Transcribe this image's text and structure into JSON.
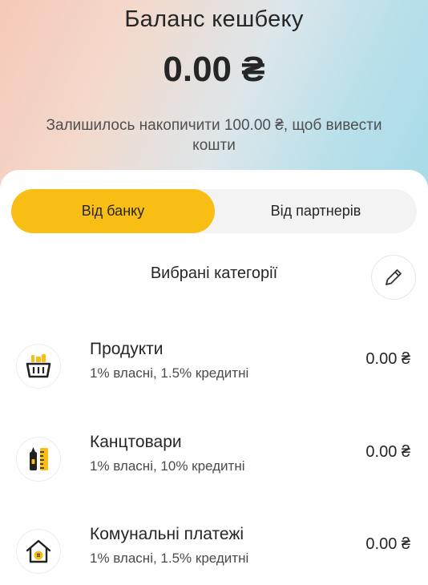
{
  "balance": {
    "title": "Баланс кешбеку",
    "amount": "0.00 ₴",
    "note": "Залишилось накопичити 100.00 ₴, щоб вивести кошти"
  },
  "tabs": [
    {
      "label": "Від банку",
      "active": true
    },
    {
      "label": "Від партнерів",
      "active": false
    }
  ],
  "categories": {
    "title": "Вибрані категорії",
    "edit_icon": "pencil-icon",
    "items": [
      {
        "name": "Продукти",
        "desc": "1% власні, 1.5% кредитні",
        "amount": "0.00 ₴",
        "icon": "grocery-basket-icon"
      },
      {
        "name": "Канцтовари",
        "desc": "1% власні, 10% кредитні",
        "amount": "0.00 ₴",
        "icon": "stationery-icon"
      },
      {
        "name": "Комунальні платежі",
        "desc": "1% власні, 1.5% кредитні",
        "amount": "0.00 ₴",
        "icon": "house-utilities-icon"
      }
    ]
  },
  "colors": {
    "accent": "#f8be14",
    "text": "#262626",
    "tab_bg": "#f3f3f3"
  }
}
